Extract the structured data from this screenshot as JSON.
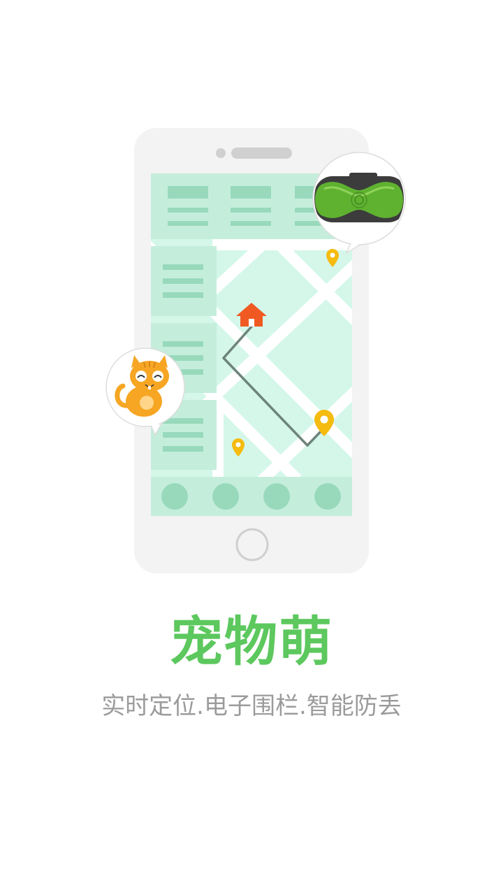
{
  "splash": {
    "title": "宠物萌",
    "subtitle": "实时定位.电子围栏.智能防丢"
  },
  "icons": {
    "pet": "cat-icon",
    "device": "gps-tracker-device-icon",
    "home": "home-icon",
    "pin": "location-pin-icon"
  },
  "colors": {
    "brand_green": "#5cc85e",
    "subtitle_gray": "#9b9b9b",
    "screen_mint": "#d4f7ea",
    "panel_mint": "#c4eedb",
    "block_green": "#98d9bc",
    "pin_yellow": "#f5bb0f",
    "home_orange": "#f05a22",
    "route_gray": "#6e847b",
    "phone_body": "#f3f3f3"
  }
}
